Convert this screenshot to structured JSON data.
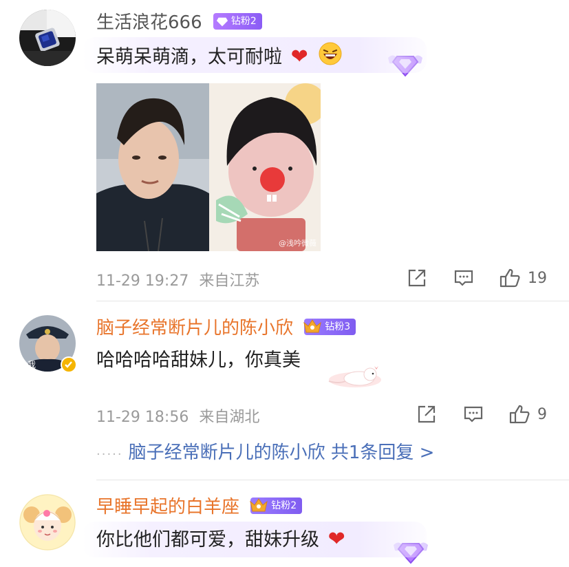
{
  "comments": [
    {
      "username": "生活浪花666",
      "badge": "钻粉2",
      "text": "呆萌呆萌滴，太可耐啦",
      "emoji_heart": "❤",
      "emoji_laugh": "😆",
      "time": "11-29 19:27",
      "location": "来自江苏",
      "likes": "19",
      "image_watermark": "@浅吟微薇"
    },
    {
      "username": "脑子经常断片儿的陈小欣",
      "badge": "钻粉3",
      "text": "哈哈哈哈甜妹儿，你真美",
      "time": "11-29 18:56",
      "location": "来自湖北",
      "likes": "9",
      "reply_dots": "·····",
      "reply_summary": "脑子经常断片儿的陈小欣  共1条回复 >"
    },
    {
      "username": "早睡早起的白羊座",
      "badge": "钻粉2",
      "text": "你比他们都可爱，甜妹升级",
      "emoji_heart": "❤"
    }
  ],
  "colors": {
    "username_default": "#555555",
    "username_orange": "#e8742a",
    "link_blue": "#4a6fb8",
    "badge_purple": "#8a5cf5",
    "meta_grey": "#9a9a9a"
  },
  "icons": [
    "share-icon",
    "comment-icon",
    "like-icon",
    "diamond-wings-icon",
    "verified-badge-icon"
  ]
}
